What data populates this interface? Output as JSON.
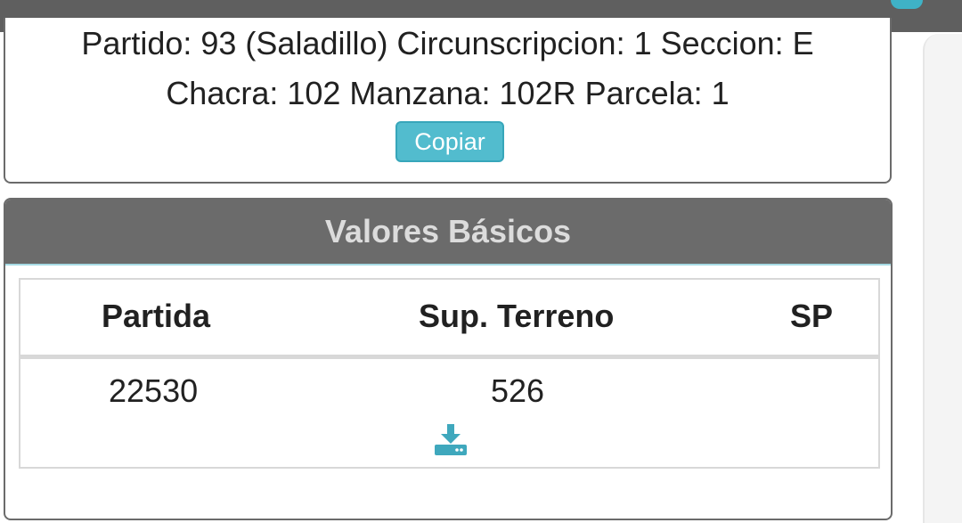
{
  "location_card": {
    "line1": "Partido: 93 (Saladillo) Circunscripcion: 1 Seccion: E",
    "line2": "Chacra: 102 Manzana: 102R Parcela: 1",
    "copy_button": "Copiar"
  },
  "basic_values": {
    "title": "Valores Básicos",
    "headers": [
      "Partida",
      "Sup. Terreno",
      "SP"
    ],
    "row": {
      "partida": "22530",
      "sup_terreno": "526",
      "sp": ""
    },
    "action_icon": "download-icon"
  },
  "colors": {
    "accent": "#52bcce",
    "header_bg": "#6b6b6b",
    "topbar_bg": "#5f5f5f"
  }
}
